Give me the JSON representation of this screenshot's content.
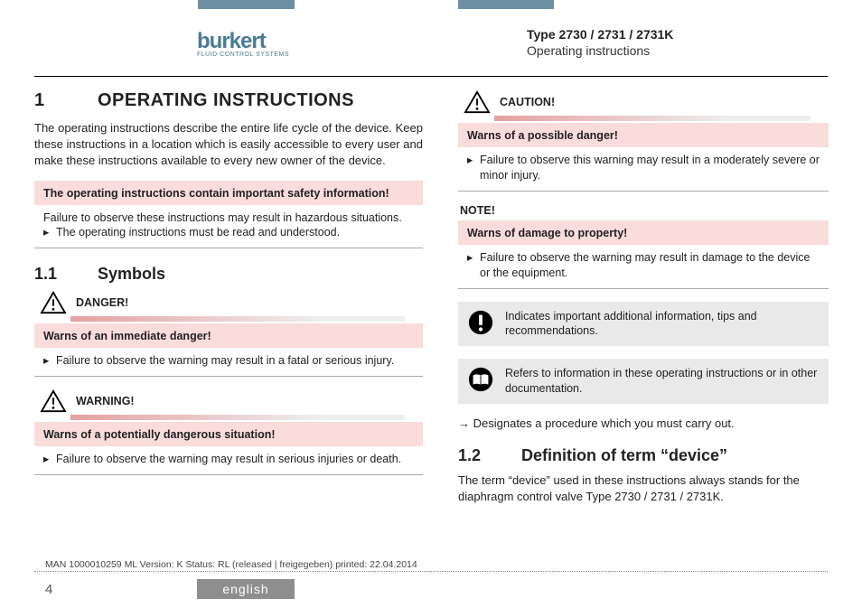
{
  "header": {
    "logo_text": "burkert",
    "logo_sub": "FLUID CONTROL SYSTEMS",
    "type_line": "Type 2730 / 2731 / 2731K",
    "subtitle": "Operating instructions"
  },
  "section1": {
    "num": "1",
    "title": "OPERATING INSTRUCTIONS",
    "intro": "The operating instructions describe the entire life cycle of the device. Keep these instructions in a location which is easily accessible to every user and make these instructions available to every new owner of the device."
  },
  "safety_box": {
    "head": "The operating instructions contain important safety information!",
    "line1": "Failure to observe these instructions may result in hazardous situations.",
    "bullet": "The operating instructions must be read and understood."
  },
  "section1_1": {
    "num": "1.1",
    "title": "Symbols"
  },
  "danger": {
    "label": "DANGER!",
    "head": "Warns of an immediate danger!",
    "bullet": "Failure to observe the warning may result in a fatal or serious injury."
  },
  "warning": {
    "label": "WARNING!",
    "head": "Warns of a potentially dangerous situation!",
    "bullet": "Failure to observe the warning may result in serious injuries or death."
  },
  "caution": {
    "label": "CAUTION!",
    "head": "Warns of a possible danger!",
    "bullet": "Failure to observe this warning may result in a moderately severe or minor injury."
  },
  "note": {
    "label": "NOTE!",
    "head": "Warns of damage to property!",
    "bullet": "Failure to observe the warning may result in damage to the device or the equipment."
  },
  "info1": "Indicates important additional information, tips and recommendations.",
  "info2": "Refers to information in these operating instructions or in other documentation.",
  "arrow_text": "Designates a procedure which you must carry out.",
  "section1_2": {
    "num": "1.2",
    "title": "Definition of term “device”",
    "body": "The term “device” used in these instructions always stands for the diaphragm control valve Type 2730 / 2731 / 2731K."
  },
  "footer": {
    "meta": "MAN 1000010259 ML  Version: K Status: RL (released | freigegeben)  printed: 22.04.2014",
    "page": "4",
    "lang": "english"
  }
}
